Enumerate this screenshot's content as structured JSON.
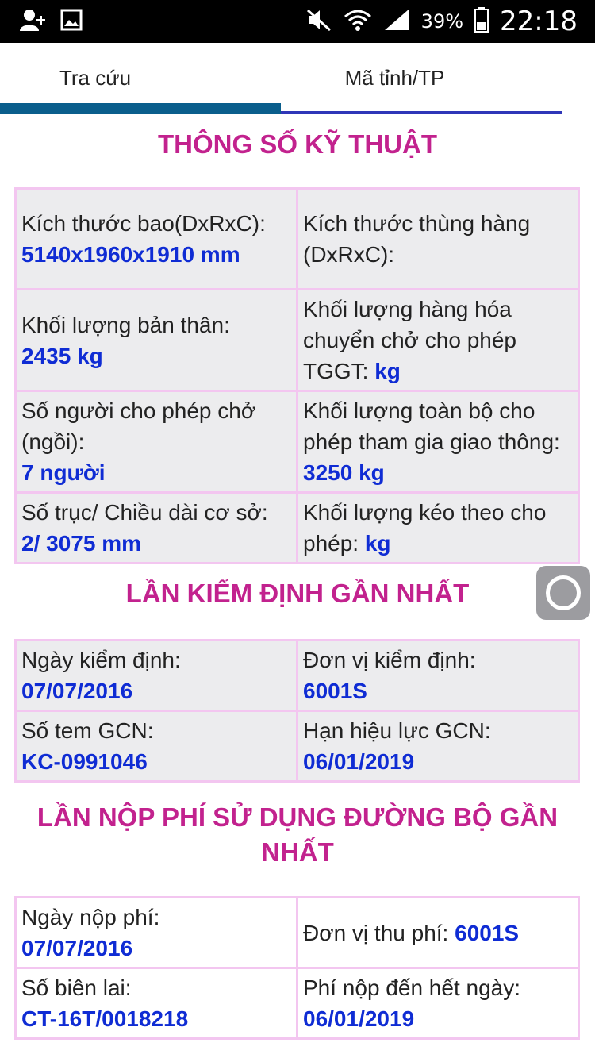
{
  "status_bar": {
    "battery": "39%",
    "time": "22:18"
  },
  "tabs": [
    {
      "label": "Tra cứu",
      "active": true
    },
    {
      "label": "Mã tỉnh/TP",
      "active": false
    }
  ],
  "specs": {
    "title": "THÔNG SỐ KỸ THUẬT",
    "dims_label": "Kích thước bao(DxRxC):",
    "dims_value": "5140x1960x1910 mm",
    "cargo_dims_label": "Kích thước thùng hàng (DxRxC):",
    "cargo_dims_value": "",
    "curb_weight_label": "Khối lượng bản thân:",
    "curb_weight_value": "2435 kg",
    "cargo_weight_label": "Khối lượng hàng hóa chuyển chở cho phép TGGT:",
    "cargo_weight_value": "kg",
    "seats_label": "Số người cho phép chở (ngồi):",
    "seats_value": "7 người",
    "gross_weight_label": "Khối lượng toàn bộ cho phép tham gia giao thông:",
    "gross_weight_value": "3250 kg",
    "axles_label": "Số trục/ Chiều dài cơ sở:",
    "axles_value": "2/ 3075 mm",
    "tow_weight_label": "Khối lượng kéo theo cho phép:",
    "tow_weight_value": "kg"
  },
  "inspection": {
    "title": "LẦN KIỂM ĐỊNH GẦN NHẤT",
    "date_label": "Ngày kiểm định:",
    "date_value": "07/07/2016",
    "unit_label": "Đơn vị kiểm định:",
    "unit_value": "6001S",
    "stamp_label": "Số tem GCN:",
    "stamp_value": "KC-0991046",
    "expiry_label": "Hạn hiệu lực GCN:",
    "expiry_value": "06/01/2019"
  },
  "fee": {
    "title": "LẦN NỘP PHÍ SỬ DỤNG ĐƯỜNG BỘ GẦN NHẤT",
    "date_label": "Ngày nộp phí:",
    "date_value": "07/07/2016",
    "unit_label": "Đơn vị thu phí:",
    "unit_value": "6001S",
    "receipt_label": "Số biên lai:",
    "receipt_value": "CT-16T/0018218",
    "paid_until_label": "Phí nộp đến hết ngày:",
    "paid_until_value": "06/01/2019"
  }
}
